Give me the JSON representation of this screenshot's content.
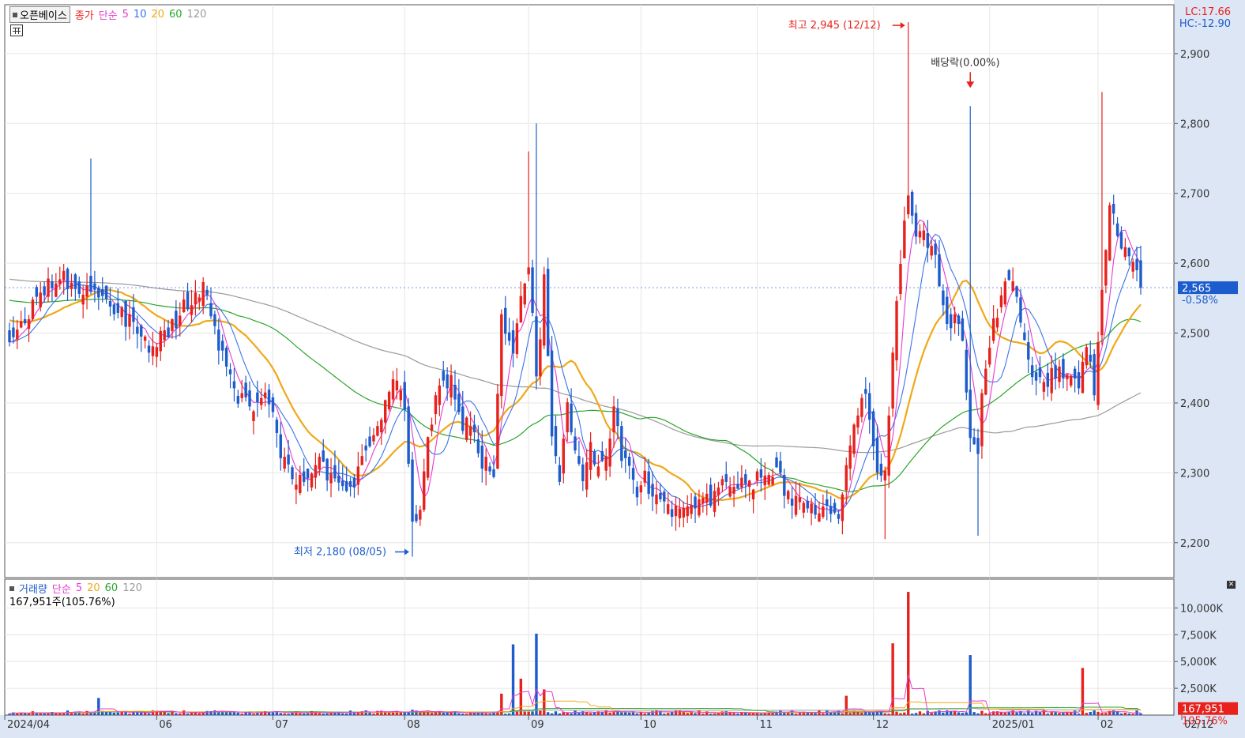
{
  "header": {
    "stock_name": "오픈베이스",
    "price_label": "종가",
    "ma_type": "단순",
    "ma_periods": [
      "5",
      "10",
      "20",
      "60",
      "120"
    ],
    "lc_label": "LC:17.66",
    "hc_label": "HC:-12.90"
  },
  "volume_header": {
    "label": "거래량",
    "ma_type": "단순",
    "ma_periods": [
      "5",
      "20",
      "60",
      "120"
    ],
    "current_text": "167,951주(105.76%)"
  },
  "colors": {
    "up": "#e8211d",
    "down": "#1d5ccc",
    "ma5": "#e43bd3",
    "ma10": "#3b73e8",
    "ma20": "#f0a818",
    "ma60": "#2aa52a",
    "ma120": "#9a9a9a",
    "axis_bg": "#dce6f5",
    "grid": "#e6e6e6"
  },
  "annotations": {
    "high": "최고 2,945 (12/12)",
    "low": "최저 2,180 (08/05)",
    "dividend": "배당락(0.00%)"
  },
  "current": {
    "price_label": "2,565",
    "change_label": "-0.58%",
    "volume_label": "167,951",
    "volume_pct_label": "105.76%"
  },
  "chart_data": [
    {
      "type": "candlestick",
      "price_ticks": [
        "2,200",
        "2,300",
        "2,400",
        "2,500",
        "2,600",
        "2,700",
        "2,800",
        "2,900"
      ],
      "price_tick_values": [
        2200,
        2300,
        2400,
        2500,
        2600,
        2700,
        2800,
        2900
      ],
      "ylim": [
        2150,
        2970
      ],
      "month_labels": [
        "2024/04",
        "06",
        "07",
        "08",
        "09",
        "10",
        "11",
        "12",
        "2025/01",
        "02",
        "02/12"
      ],
      "month_label_index": [
        0,
        38,
        68,
        102,
        134,
        163,
        193,
        223,
        253,
        281,
        300
      ],
      "key_points": [
        {
          "label": "최고 2,945 (12/12)",
          "date": "12/12",
          "value": 2945
        },
        {
          "label": "최저 2,180 (08/05)",
          "date": "08/05",
          "value": 2180
        }
      ],
      "close_shape": [
        [
          0,
          2480
        ],
        [
          8,
          2560
        ],
        [
          14,
          2580
        ],
        [
          20,
          2560
        ],
        [
          25,
          2545
        ],
        [
          30,
          2520
        ],
        [
          36,
          2480
        ],
        [
          42,
          2510
        ],
        [
          48,
          2560
        ],
        [
          50,
          2560
        ],
        [
          53,
          2500
        ],
        [
          56,
          2460
        ],
        [
          58,
          2420
        ],
        [
          60,
          2400
        ],
        [
          62,
          2390
        ],
        [
          66,
          2410
        ],
        [
          68,
          2380
        ],
        [
          70,
          2330
        ],
        [
          72,
          2300
        ],
        [
          76,
          2280
        ],
        [
          80,
          2310
        ],
        [
          84,
          2290
        ],
        [
          88,
          2270
        ],
        [
          91,
          2310
        ],
        [
          94,
          2360
        ],
        [
          98,
          2410
        ],
        [
          100,
          2440
        ],
        [
          102,
          2400
        ],
        [
          104,
          2220
        ],
        [
          106,
          2240
        ],
        [
          108,
          2350
        ],
        [
          110,
          2410
        ],
        [
          114,
          2430
        ],
        [
          117,
          2360
        ],
        [
          119,
          2380
        ],
        [
          122,
          2320
        ],
        [
          125,
          2290
        ],
        [
          127,
          2520
        ],
        [
          130,
          2460
        ],
        [
          132,
          2560
        ],
        [
          134,
          2600
        ],
        [
          136,
          2440
        ],
        [
          138,
          2570
        ],
        [
          140,
          2350
        ],
        [
          142,
          2290
        ],
        [
          144,
          2400
        ],
        [
          146,
          2340
        ],
        [
          148,
          2300
        ],
        [
          150,
          2350
        ],
        [
          152,
          2300
        ],
        [
          154,
          2320
        ],
        [
          156,
          2390
        ],
        [
          158,
          2330
        ],
        [
          160,
          2300
        ],
        [
          162,
          2260
        ],
        [
          164,
          2290
        ],
        [
          168,
          2260
        ],
        [
          172,
          2240
        ],
        [
          176,
          2250
        ],
        [
          180,
          2260
        ],
        [
          184,
          2280
        ],
        [
          188,
          2280
        ],
        [
          192,
          2290
        ],
        [
          196,
          2300
        ],
        [
          198,
          2310
        ],
        [
          200,
          2280
        ],
        [
          202,
          2260
        ],
        [
          206,
          2250
        ],
        [
          210,
          2250
        ],
        [
          214,
          2240
        ],
        [
          216,
          2300
        ],
        [
          218,
          2370
        ],
        [
          220,
          2420
        ],
        [
          222,
          2380
        ],
        [
          224,
          2290
        ],
        [
          226,
          2300
        ],
        [
          228,
          2480
        ],
        [
          230,
          2600
        ],
        [
          232,
          2700
        ],
        [
          234,
          2650
        ],
        [
          236,
          2640
        ],
        [
          238,
          2620
        ],
        [
          240,
          2580
        ],
        [
          242,
          2510
        ],
        [
          244,
          2520
        ],
        [
          246,
          2490
        ],
        [
          248,
          2350
        ],
        [
          250,
          2340
        ],
        [
          252,
          2460
        ],
        [
          254,
          2510
        ],
        [
          256,
          2560
        ],
        [
          258,
          2580
        ],
        [
          260,
          2540
        ],
        [
          262,
          2500
        ],
        [
          264,
          2450
        ],
        [
          266,
          2430
        ],
        [
          270,
          2440
        ],
        [
          274,
          2450
        ],
        [
          276,
          2430
        ],
        [
          278,
          2490
        ],
        [
          280,
          2420
        ],
        [
          282,
          2570
        ],
        [
          284,
          2670
        ],
        [
          286,
          2650
        ],
        [
          288,
          2610
        ],
        [
          290,
          2590
        ],
        [
          292,
          2565
        ]
      ],
      "ma_start_values": {
        "ma120": 2578,
        "ma60": 2548
      }
    },
    {
      "type": "bar",
      "title": "거래량",
      "volume_ticks": [
        "2,500K",
        "5,000K",
        "7,500K",
        "10,000K"
      ],
      "volume_tick_values": [
        2500,
        5000,
        7500,
        10000
      ],
      "ylim": [
        0,
        11800
      ],
      "spikes": [
        {
          "index": 23,
          "value": 1600
        },
        {
          "index": 104,
          "value": 500
        },
        {
          "index": 127,
          "value": 2000
        },
        {
          "index": 130,
          "value": 6600
        },
        {
          "index": 132,
          "value": 3400
        },
        {
          "index": 136,
          "value": 7600
        },
        {
          "index": 138,
          "value": 2400
        },
        {
          "index": 216,
          "value": 1800
        },
        {
          "index": 228,
          "value": 6700
        },
        {
          "index": 232,
          "value": 11500
        },
        {
          "index": 248,
          "value": 5600
        },
        {
          "index": 277,
          "value": 4400
        }
      ],
      "current_volume": 167951
    }
  ]
}
